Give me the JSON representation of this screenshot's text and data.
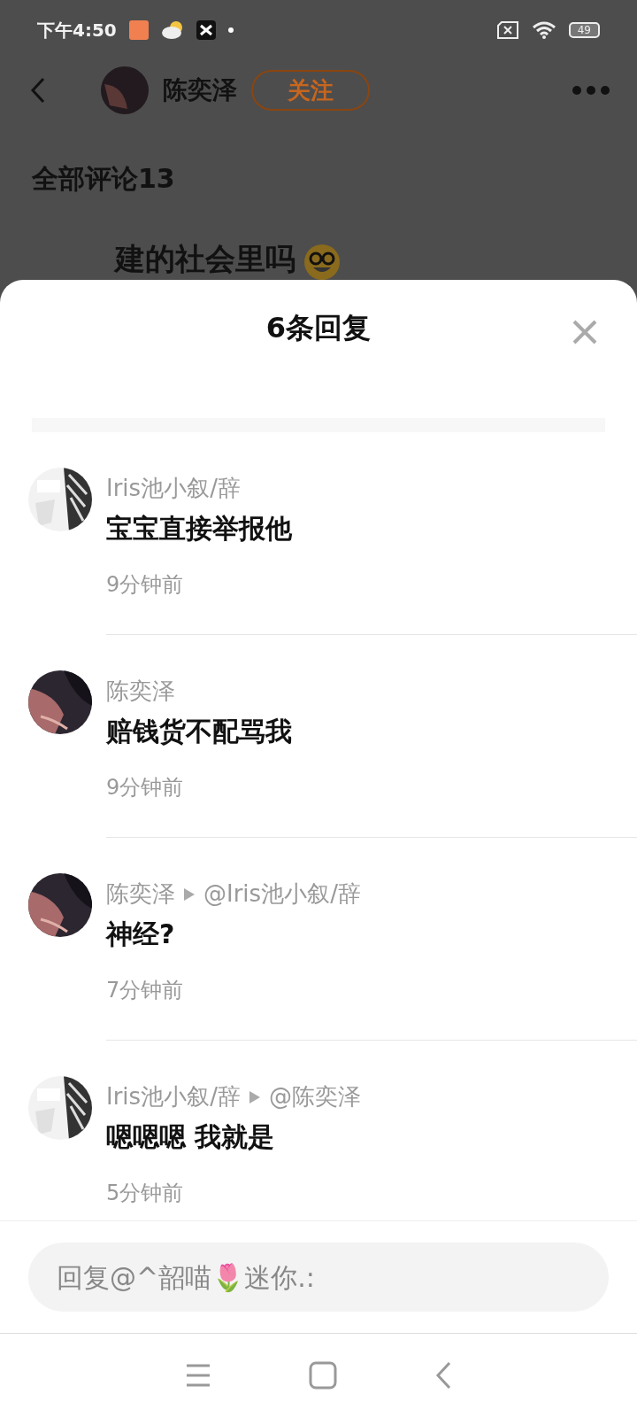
{
  "status_bar": {
    "time": "下午4:50",
    "battery": "49"
  },
  "header": {
    "name": "陈奕泽",
    "follow_button": "关注"
  },
  "comments_heading": "全部评论13",
  "background_comment": {
    "text": "建的社会里吗"
  },
  "replies_sheet": {
    "title": "6条回复",
    "replies": [
      {
        "author": "Iris池小叙/辞",
        "text": "宝宝直接举报他",
        "time": "9分钟前"
      },
      {
        "author": "陈奕泽",
        "text": "赔钱货不配骂我",
        "time": "9分钟前"
      },
      {
        "author": "陈奕泽",
        "reply_to": "@Iris池小叙/辞",
        "text": "神经?",
        "time": "7分钟前"
      },
      {
        "author": "Iris池小叙/辞",
        "reply_to": "@陈奕泽",
        "text": "嗯嗯嗯 我就是",
        "time": "5分钟前"
      }
    ]
  },
  "reply_input": {
    "placeholder": "回复@^韶喵🌷迷你.:"
  }
}
